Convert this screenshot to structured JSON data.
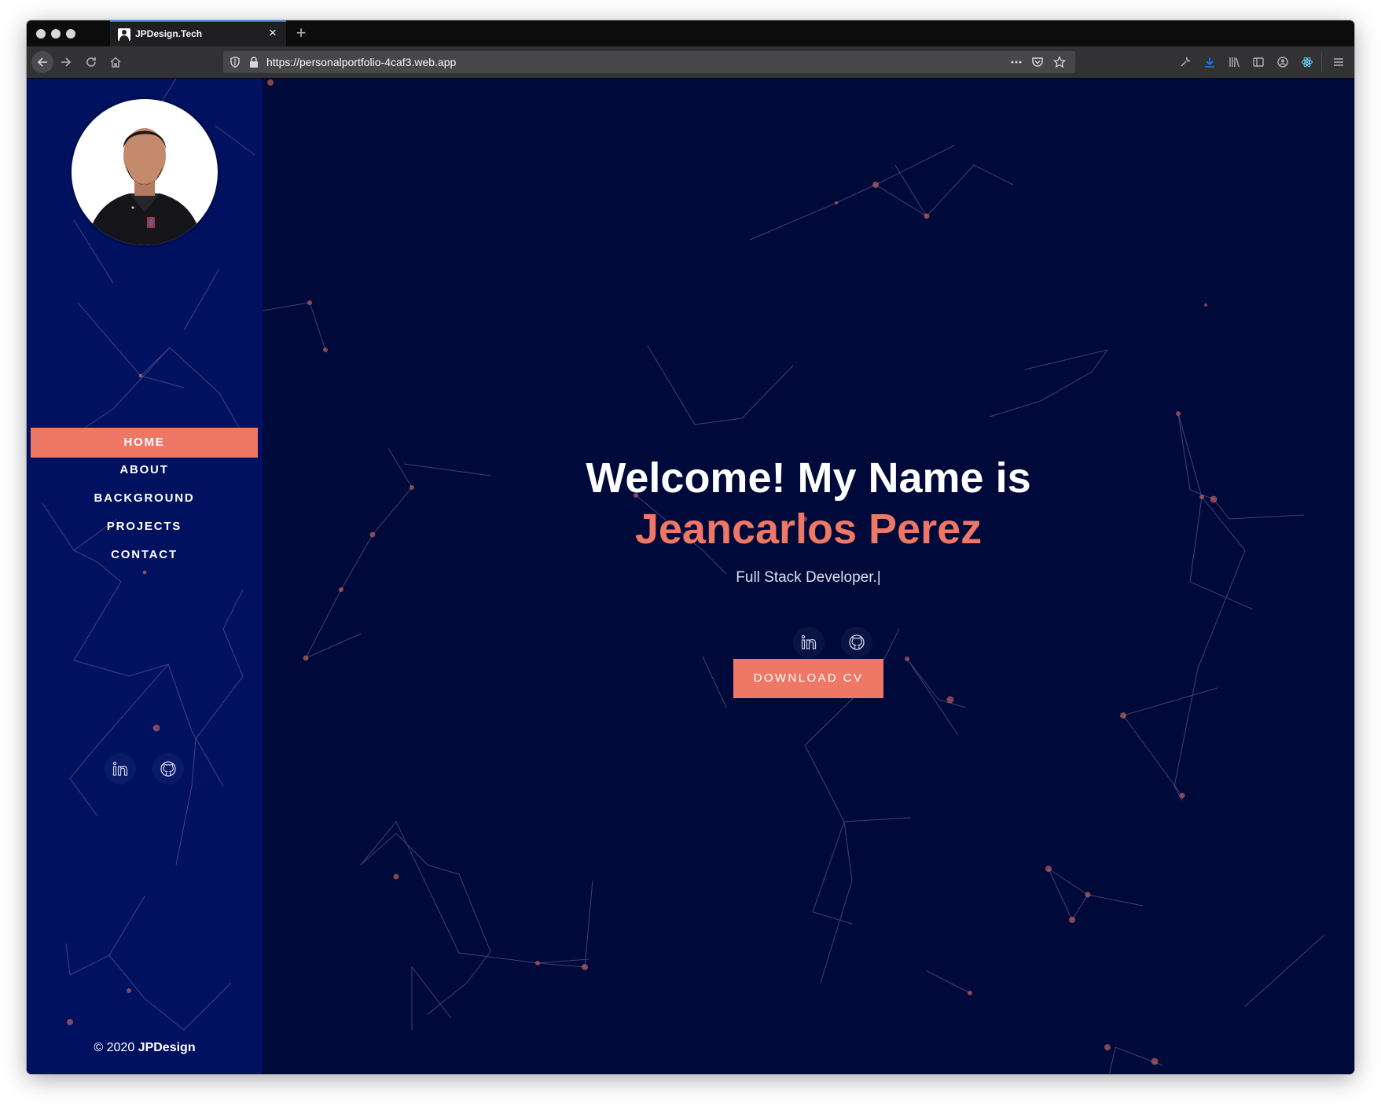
{
  "browser": {
    "tab_title": "JPDesign.Tech",
    "url": "https://personalportfolio-4caf3.web.app"
  },
  "sidebar": {
    "nav": [
      {
        "label": "HOME",
        "active": true
      },
      {
        "label": "ABOUT",
        "active": false
      },
      {
        "label": "BACKGROUND",
        "active": false
      },
      {
        "label": "PROJECTS",
        "active": false
      },
      {
        "label": "CONTACT",
        "active": false
      }
    ],
    "copyright_prefix": "© 2020 ",
    "copyright_brand": "JPDesign"
  },
  "hero": {
    "greeting": "Welcome! My Name is",
    "name": "Jeancarlos Perez",
    "role": "Full Stack Developer.|",
    "cv_button": "DOWNLOAD CV"
  },
  "icons": {
    "social": [
      "linkedin-icon",
      "github-icon"
    ]
  },
  "colors": {
    "accent": "#ef7765",
    "sidebar_bg": "#001160",
    "page_bg": "#000a3a",
    "chrome_dark": "#0c0c0d",
    "chrome_toolbar": "#323234"
  }
}
